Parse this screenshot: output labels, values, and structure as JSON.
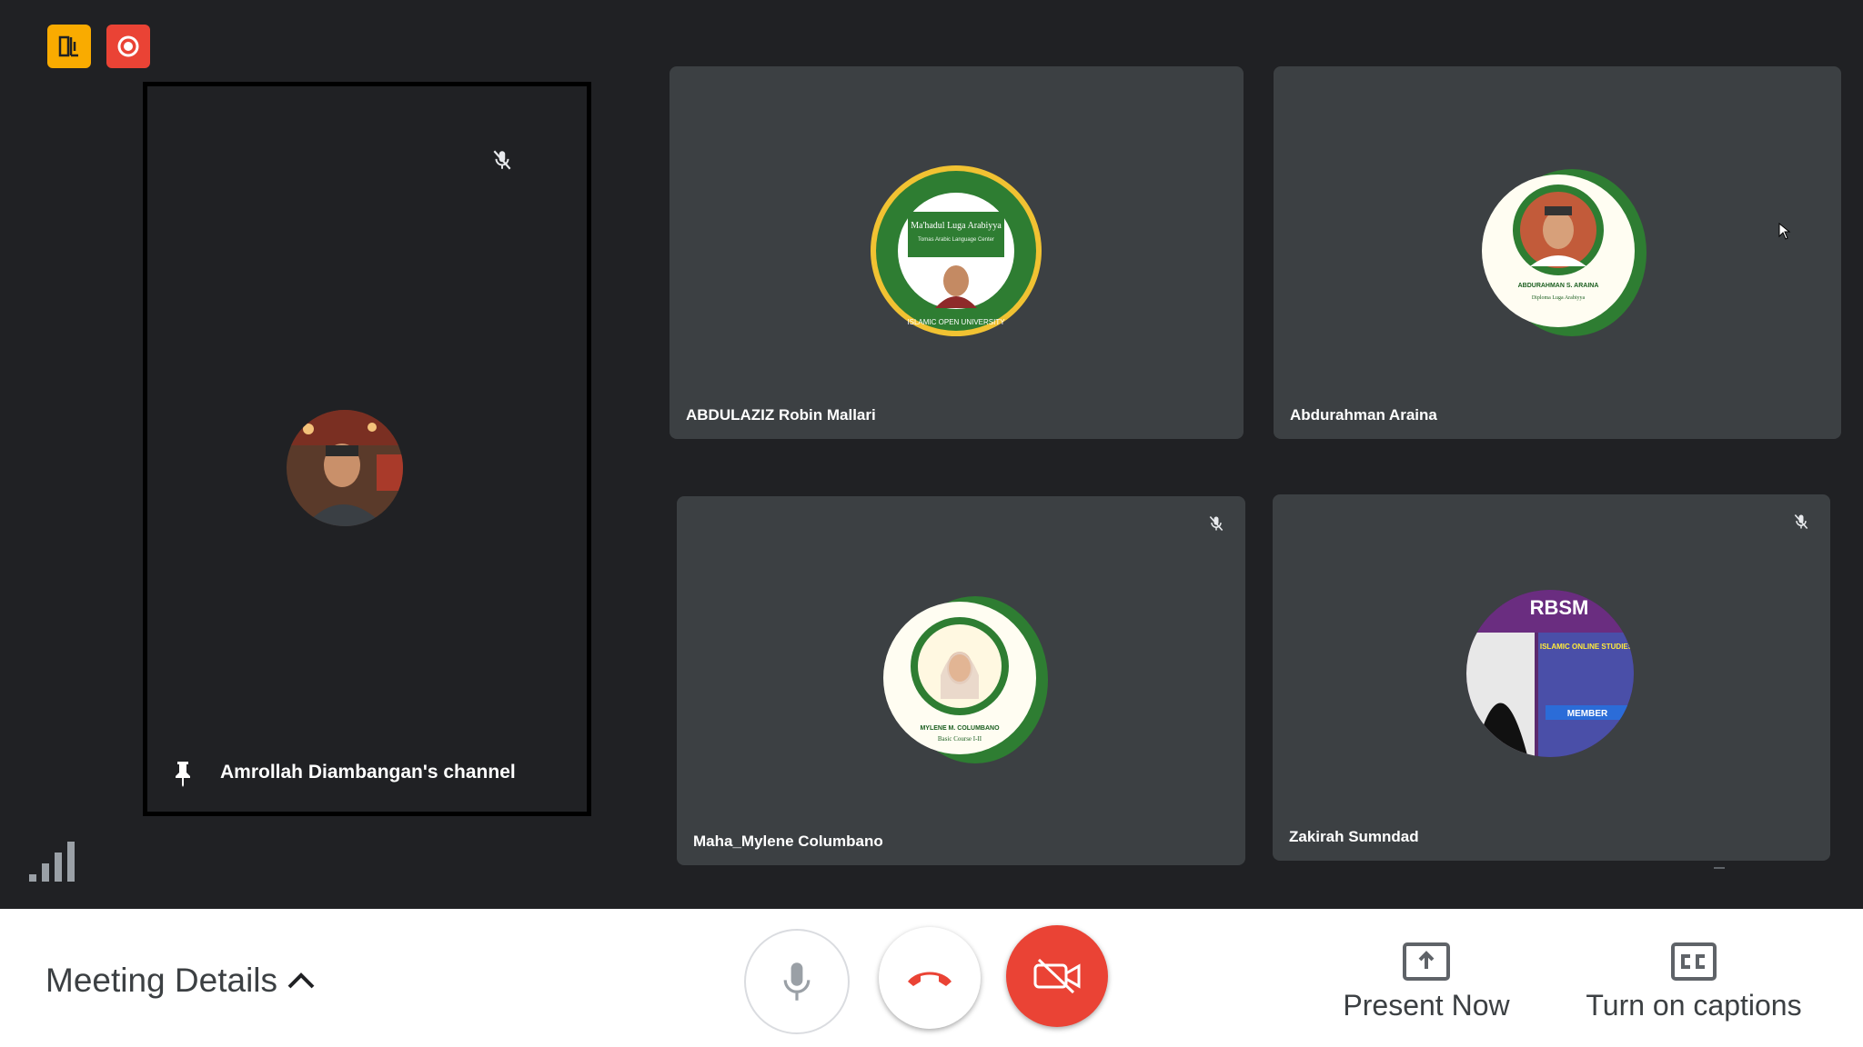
{
  "pinned": {
    "name": "Amrollah Diambangan's channel",
    "icons": [
      "mic-off-icon",
      "pin-icon"
    ]
  },
  "tiles": [
    {
      "name": "ABDULAZIZ Robin Mallari",
      "muted": false,
      "avatar_text": {
        "line1": "Ma'hadul Luga Arabiyya",
        "line2": "Tomas Arabic Language Center",
        "ring": "ISLAMIC OPEN UNIVERSITY"
      }
    },
    {
      "name": "Abdurahman Araina",
      "muted": false,
      "avatar_text": {
        "line1": "ABDURAHMAN S. ARAINA",
        "line2": "Diploma Luga Arabiyya"
      }
    },
    {
      "name": "Maha_Mylene Columbano",
      "muted": true,
      "avatar_text": {
        "line1": "MYLENE M. COLUMBANO",
        "line2": "Basic Course I-II"
      }
    },
    {
      "name": "Zakirah Sumndad",
      "muted": true,
      "avatar_text": {
        "line1": "RBSM",
        "line2": "ISLAMIC ONLINE STUDIES",
        "line3": "MEMBER"
      }
    }
  ],
  "controls": {
    "meeting_details": "Meeting Details",
    "present_now": "Present Now",
    "captions": "Turn on captions"
  },
  "colors": {
    "background": "#202124",
    "tile": "#3c4043",
    "danger": "#ea4335",
    "warning": "#f9ab00",
    "bar": "#ffffff"
  }
}
